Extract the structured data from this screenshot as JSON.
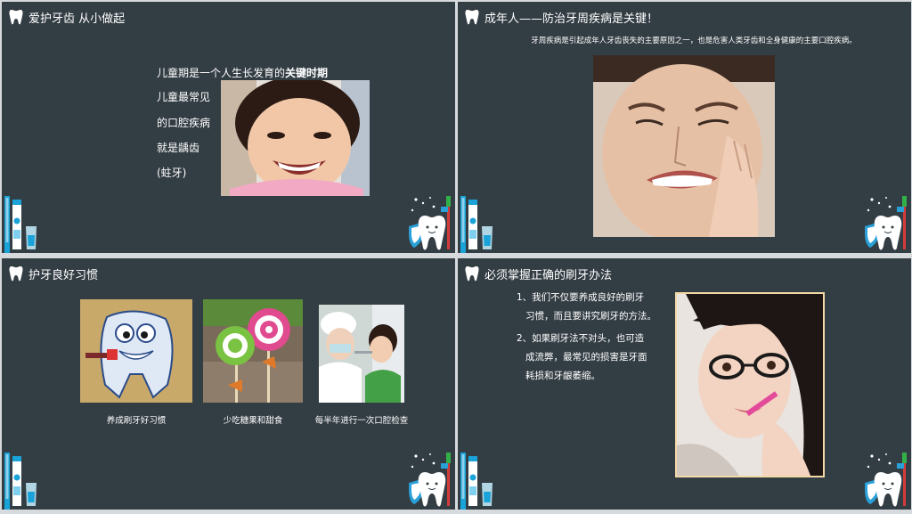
{
  "slides": [
    {
      "title": "爱护牙齿 从小做起",
      "lines": [
        "儿童期是一个人生长发育的",
        "关键时期",
        "儿童最常见",
        "的口腔疾病",
        "就是龋齿",
        "(蛀牙)"
      ]
    },
    {
      "title": "成年人——防治牙周疾病是关键！",
      "description": "牙周疾病是引起成年人牙齿丧失的主要原因之一，也是危害人类牙齿和全身健康的主要口腔疾病。"
    },
    {
      "title": "护牙良好习惯",
      "captions": [
        "养成刷牙好习惯",
        "少吃糖果和甜食",
        "每半年进行一次口腔检查"
      ]
    },
    {
      "title": "必须掌握正确的刷牙办法",
      "tips": [
        [
          "1、我们不仅要养成良好的刷牙",
          "习惯，而且要讲究刷牙的方法。"
        ],
        [
          "2、如果刷牙法不对头，也可造",
          "成流弊，最常见的损害是牙面",
          "耗损和牙龈萎缩。"
        ]
      ]
    }
  ],
  "icons": {
    "title_icon": "tooth-icon",
    "left_decoration": "toothpaste-and-cup-icon",
    "right_decoration": "tooth-with-brush-icon"
  },
  "colors": {
    "slide_background": "#333d44",
    "page_gap": "#d7dadd",
    "text": "#ffffff"
  }
}
